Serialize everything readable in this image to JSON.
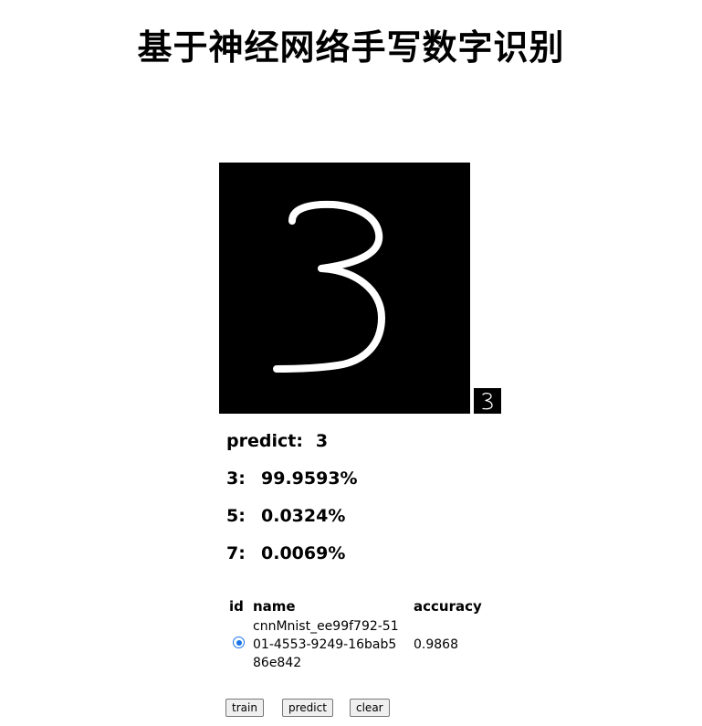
{
  "page": {
    "title": "基于神经网络手写数字识别"
  },
  "drawing": {
    "canvas_digit": "3",
    "thumbnail_digit": "3"
  },
  "prediction": {
    "label": "predict:",
    "value": "3",
    "top": [
      {
        "digit": "3:",
        "prob": "99.9593%"
      },
      {
        "digit": "5:",
        "prob": "0.0324%"
      },
      {
        "digit": "7:",
        "prob": "0.0069%"
      }
    ]
  },
  "models": {
    "headers": {
      "id": "id",
      "name": "name",
      "accuracy": "accuracy"
    },
    "rows": [
      {
        "selected": true,
        "name": "cnnMnist_ee99f792-5101-4553-9249-16bab586e842",
        "accuracy": "0.9868"
      }
    ]
  },
  "buttons": {
    "train": "train",
    "predict": "predict",
    "clear": "clear"
  }
}
